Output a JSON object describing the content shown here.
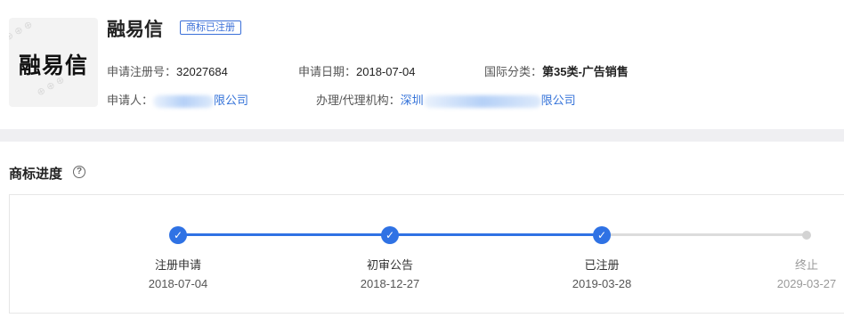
{
  "trademark": {
    "logo_text": "融易信",
    "name": "融易信",
    "status_badge": "商标已注册"
  },
  "details": {
    "reg_no_label": "申请注册号：",
    "reg_no": "32027684",
    "apply_date_label": "申请日期：",
    "apply_date": "2018-07-04",
    "intl_class_label": "国际分类：",
    "intl_class": "第35类-广告销售",
    "applicant_label": "申请人：",
    "applicant_suffix": "限公司",
    "agency_label": "办理/代理机构：",
    "agency_prefix": "深圳",
    "agency_suffix": "限公司"
  },
  "progress": {
    "title": "商标进度",
    "help_icon": "?",
    "steps": [
      {
        "label": "注册申请",
        "date": "2018-07-04",
        "status": "done"
      },
      {
        "label": "初审公告",
        "date": "2018-12-27",
        "status": "done"
      },
      {
        "label": "已注册",
        "date": "2019-03-28",
        "status": "done"
      },
      {
        "label": "终止",
        "date": "2029-03-27",
        "status": "pending"
      }
    ]
  },
  "colors": {
    "accent": "#2f72e4",
    "link": "#3573d9",
    "pending": "#d3d3d3"
  }
}
